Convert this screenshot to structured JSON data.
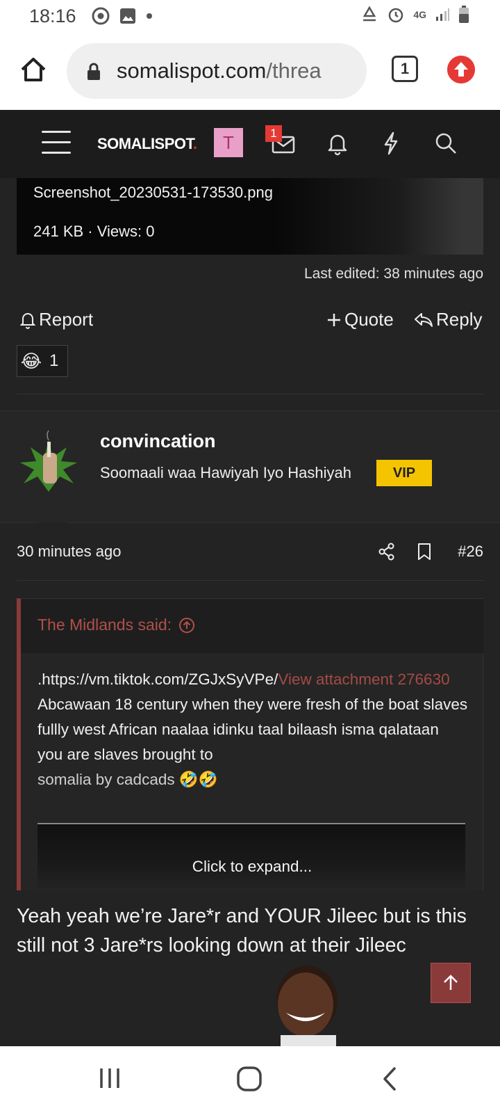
{
  "status_bar": {
    "time": "18:16",
    "network": "4G"
  },
  "browser": {
    "url_domain": "somalispot.com",
    "url_path": "/threa",
    "tab_count": "1"
  },
  "site_header": {
    "logo": "SOMALISPOT",
    "logo_dot": ".",
    "avatar_letter": "T",
    "inbox_badge": "1"
  },
  "attachment": {
    "filename": "Screenshot_20230531-173530.png",
    "meta": "241 KB · Views: 0"
  },
  "previous_post": {
    "last_edited": "Last edited: 38 minutes ago",
    "report_label": "Report",
    "quote_label": "Quote",
    "reply_label": "Reply",
    "reaction_emoji": "😂",
    "reaction_count": "1"
  },
  "post": {
    "username": "convincation",
    "user_title": "Soomaali waa Hawiyah Iyo Hashiyah",
    "badge": "VIP",
    "time": "30 minutes ago",
    "post_number": "#26",
    "quote": {
      "author": "The Midlands said:",
      "url_text": ".https://vm.tiktok.com/ZGJxSyVPe/",
      "attachment_link": "View attachment 276630",
      "text": "Abcawaan 18 century when they were fresh of the boat slaves fullly west African naalaa idinku taal bilaash isma qalataan you are slaves brought to",
      "last_line": "somalia by cadcads 🤣🤣",
      "expand_label": "Click to expand..."
    },
    "body": "Yeah yeah we’re Jare*r and YOUR Jileec but is this still not 3 Jare*rs looking down at their Jileec"
  },
  "colors": {
    "background": "#232323",
    "header": "#1c1c1c",
    "accent_red": "#8b3a3a",
    "vip": "#f5c400",
    "link": "#a54a45"
  }
}
